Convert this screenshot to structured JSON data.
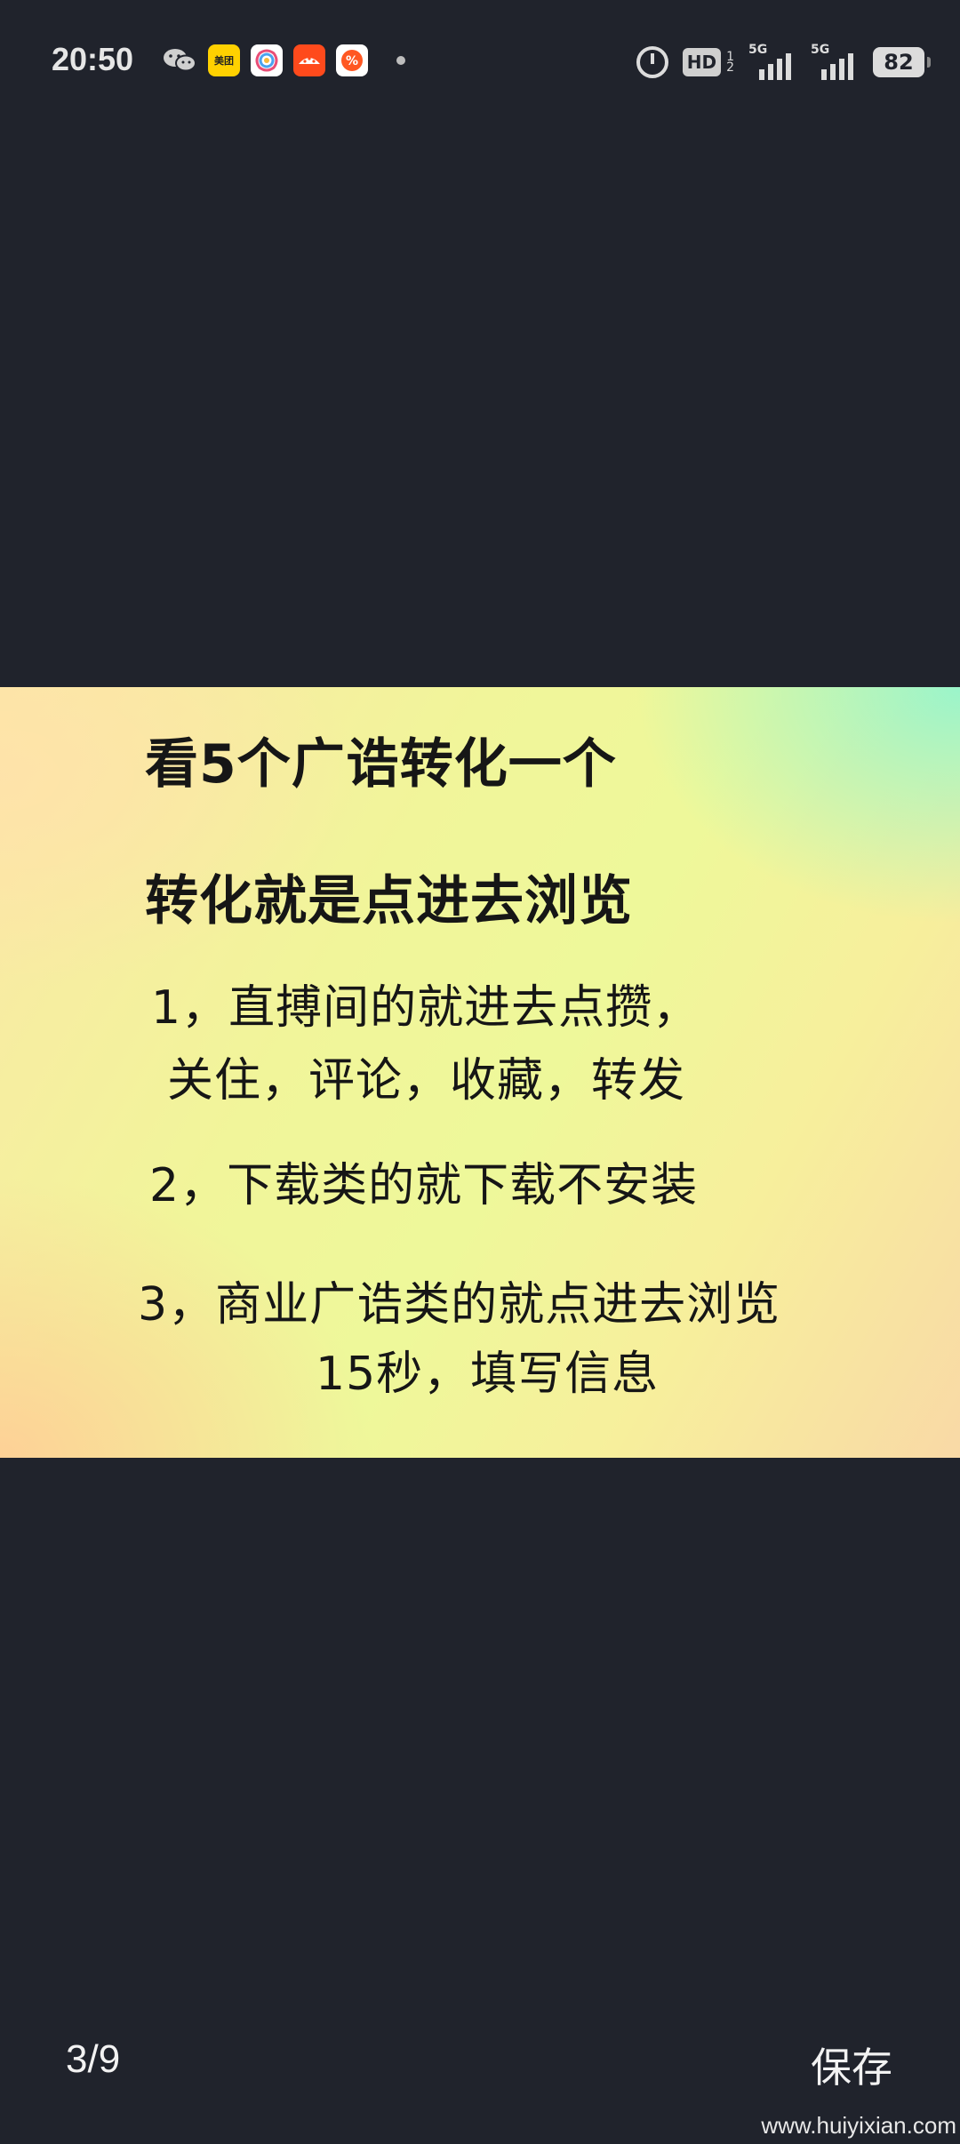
{
  "status_bar": {
    "time": "20:50",
    "notification_icons": [
      "wechat-icon",
      "meituan-icon",
      "colorful-app-icon",
      "red-app-icon",
      "redpacket-app-icon"
    ],
    "meituan_label": "美团",
    "hd_label": "HD",
    "hd_sub": [
      "1",
      "2"
    ],
    "signal1_label": "5G",
    "signal2_label": "5G",
    "battery": "82"
  },
  "image": {
    "title_line1": "看5个广诰转化一个",
    "title_line2": "转化就是点进去浏览",
    "item1_line1": "1，直搏间的就进去点攒，",
    "item1_line2": "关住，评论，收藏，转发",
    "item2_line1": "2，下载类的就下载不安装",
    "item3_line1": "3，商业广诰类的就点进去浏览",
    "item3_line2": "15秒，填写信息",
    "colors": {
      "background_green": "#96f5cd",
      "background_yellow": "#eef89a",
      "background_peach": "#f9d9a6",
      "text": "#161616"
    }
  },
  "footer": {
    "page_indicator": "3/9",
    "save_label": "保存",
    "watermark": "www.huiyixian.com"
  },
  "colors": {
    "background": "#20232c",
    "foreground": "#f2f2f2"
  }
}
